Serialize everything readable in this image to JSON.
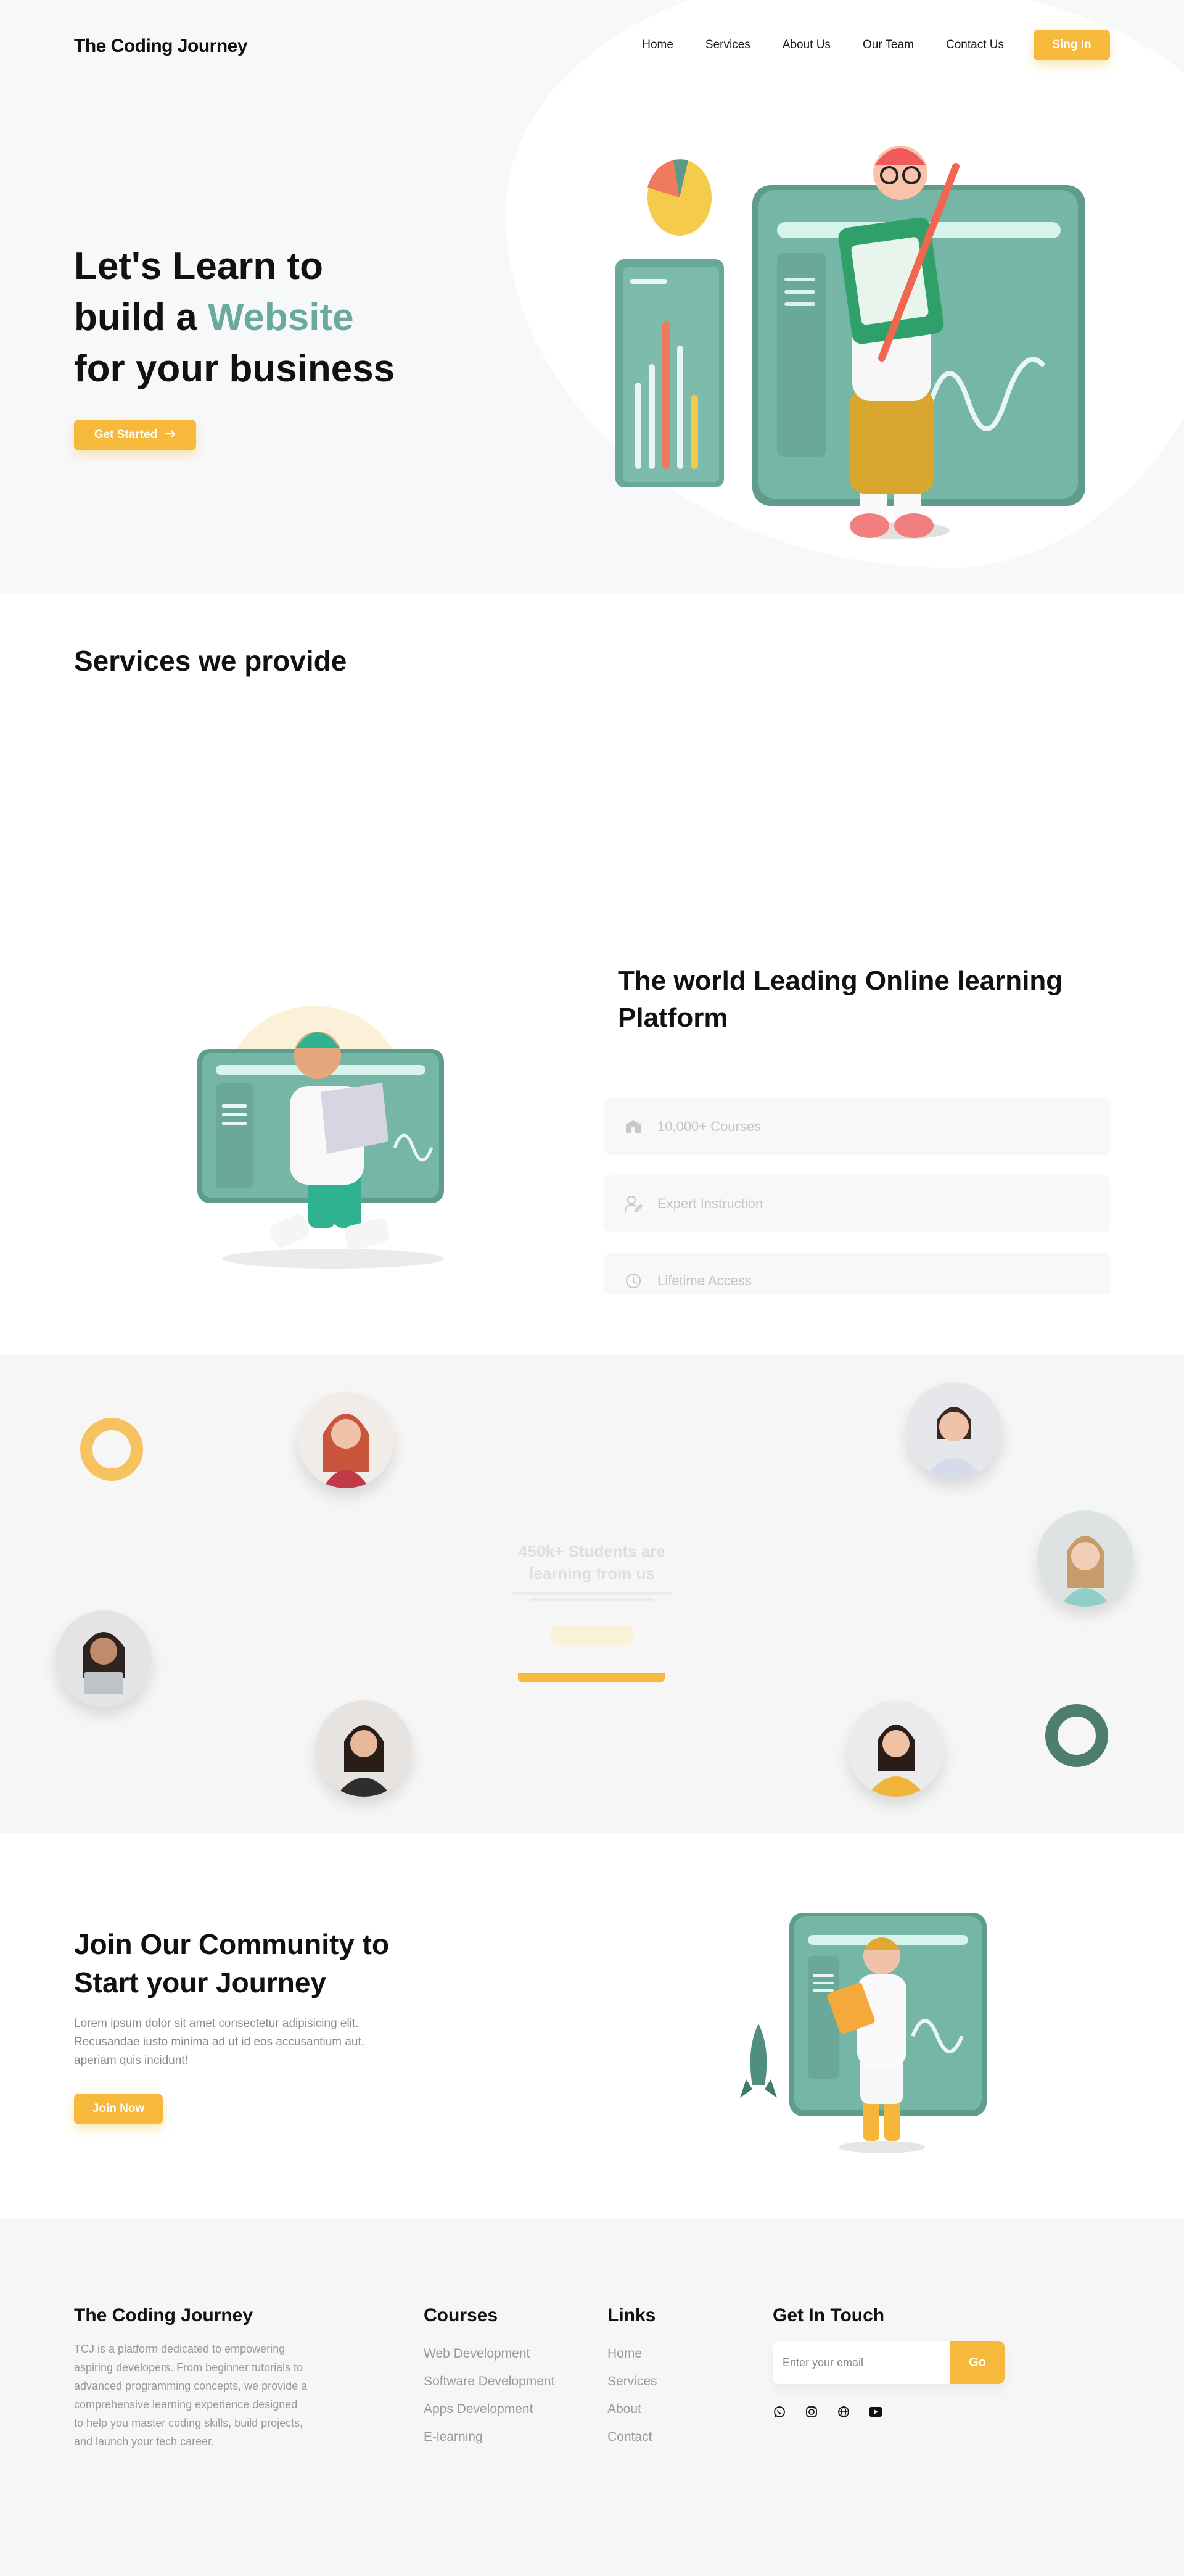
{
  "nav": {
    "brand": "The Coding Journey",
    "links": [
      "Home",
      "Services",
      "About Us",
      "Our Team",
      "Contact Us"
    ],
    "signin_label": "Sing In"
  },
  "hero": {
    "title_line1": "Let's Learn to",
    "title_line2_prefix": "build a ",
    "title_line2_accent": "Website",
    "title_line3": "for your business",
    "cta_label": "Get Started",
    "illustration": "3d-character-with-pencil-and-dashboard-icon"
  },
  "services": {
    "title": "Services we provide"
  },
  "platform": {
    "title": "The world Leading Online learning Platform",
    "features": [
      {
        "icon": "courses-icon",
        "label": "10,000+ Courses"
      },
      {
        "icon": "instructor-icon",
        "label": "Expert Instruction"
      },
      {
        "icon": "clock-icon",
        "label": "Lifetime Access"
      }
    ]
  },
  "students": {
    "title": "450k+ Students are learning from us"
  },
  "community": {
    "title": "Join Our Community to Start your Journey",
    "text": "Lorem ipsum dolor sit amet consectetur adipisicing elit. Recusandae iusto minima ad ut id eos accusantium aut, aperiam quis incidunt!",
    "cta_label": "Join Now"
  },
  "footer": {
    "brand": "The Coding Journey",
    "description": "TCJ is a platform dedicated to empowering aspiring developers. From beginner tutorials to advanced programming concepts, we provide a comprehensive learning experience designed to help you master coding skills, build projects, and launch your tech career.",
    "courses_title": "Courses",
    "courses": [
      "Web Development",
      "Software Development",
      "Apps Development",
      "E-learning"
    ],
    "links_title": "Links",
    "links": [
      "Home",
      "Services",
      "About",
      "Contact"
    ],
    "touch_title": "Get In Touch",
    "email_placeholder": "Enter your email",
    "go_label": "Go",
    "socials": [
      "whatsapp-icon",
      "instagram-icon",
      "globe-icon",
      "youtube-icon"
    ]
  },
  "colors": {
    "accent_yellow": "#f6b93b",
    "accent_teal": "#6aaa9a",
    "dark_teal": "#4e7e70"
  }
}
